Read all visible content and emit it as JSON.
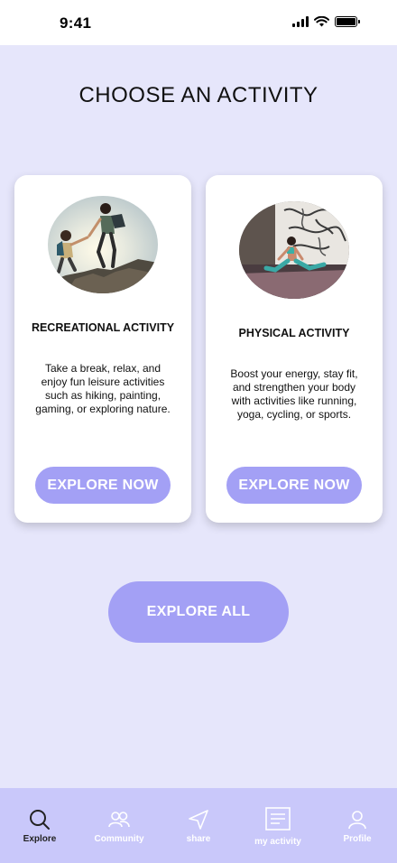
{
  "status_bar": {
    "time": "9:41"
  },
  "page": {
    "title": "CHOOSE AN ACTIVITY"
  },
  "cards": [
    {
      "title": "RECREATIONAL ACTIVITY",
      "description": "Take a break, relax, and enjoy fun leisure activities such as hiking, painting, gaming, or exploring nature.",
      "button_label": "EXPLORE NOW",
      "image_icon": "hiking-photo"
    },
    {
      "title": "PHYSICAL ACTIVITY",
      "description": "Boost your energy, stay fit, and strengthen your body with activities like running, yoga, cycling, or sports.",
      "button_label": "EXPLORE NOW",
      "image_icon": "yoga-photo"
    }
  ],
  "explore_all_label": "EXPLORE ALL",
  "tabs": [
    {
      "label": "Explore",
      "icon": "search-icon",
      "active": true
    },
    {
      "label": "Community",
      "icon": "people-icon",
      "active": false
    },
    {
      "label": "share",
      "icon": "send-icon",
      "active": false
    },
    {
      "label": "my activity",
      "icon": "document-icon",
      "active": false
    },
    {
      "label": "Profile",
      "icon": "user-icon",
      "active": false
    }
  ],
  "colors": {
    "background": "#E6E6FB",
    "button": "#A3A0F5",
    "tab_bar": "#C9C8FA"
  }
}
